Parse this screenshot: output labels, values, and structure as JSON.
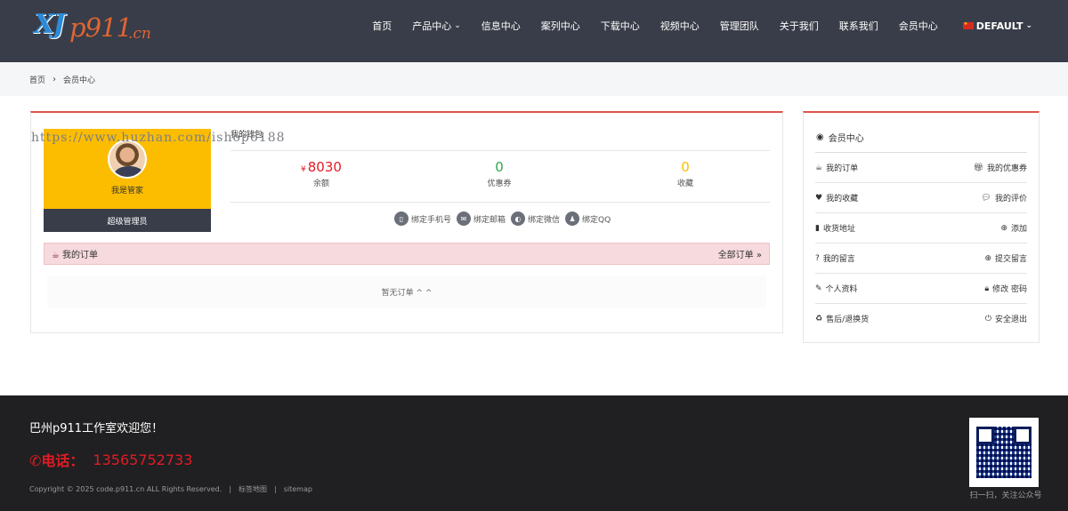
{
  "header": {
    "logo_parts": [
      "XJ",
      "p911",
      ".cn"
    ],
    "nav": [
      {
        "label": "首页",
        "chevron": false
      },
      {
        "label": "产品中心",
        "chevron": true
      },
      {
        "label": "信息中心",
        "chevron": false
      },
      {
        "label": "案列中心",
        "chevron": false
      },
      {
        "label": "下载中心",
        "chevron": false
      },
      {
        "label": "视频中心",
        "chevron": false
      },
      {
        "label": "管理团队",
        "chevron": false
      },
      {
        "label": "关于我们",
        "chevron": false
      },
      {
        "label": "联系我们",
        "chevron": false
      },
      {
        "label": "会员中心",
        "chevron": false
      }
    ],
    "language": "DEFAULT"
  },
  "breadcrumb": [
    "首页",
    "会员中心"
  ],
  "watermark": "https://www.huzhan.com/ishop6188",
  "profile": {
    "name": "我是管家",
    "role": "超级管理员"
  },
  "wallet": {
    "title": "我的钱包",
    "currency": "¥",
    "stats": [
      {
        "value": "8030",
        "label": "余额",
        "color": "#e31b23"
      },
      {
        "value": "0",
        "label": "优惠券",
        "color": "#2fa84f"
      },
      {
        "value": "0",
        "label": "收藏",
        "color": "#fcbd00"
      }
    ],
    "binds": [
      {
        "icon": "phone-icon",
        "glyph": "▯",
        "label": "绑定手机号"
      },
      {
        "icon": "mail-icon",
        "glyph": "✉",
        "label": "绑定邮箱"
      },
      {
        "icon": "wechat-icon",
        "glyph": "◐",
        "label": "绑定微信"
      },
      {
        "icon": "qq-icon",
        "glyph": "♟",
        "label": "绑定QQ"
      }
    ]
  },
  "orders": {
    "title": "我的订单",
    "all_link": "全部订单",
    "empty_text": "暂无订单 ^ ^"
  },
  "sidebar": {
    "title": "会员中心",
    "rows": [
      {
        "left": "我的订单",
        "left_icon": "orders-icon",
        "right": "我的优惠券",
        "right_icon": "gift-icon"
      },
      {
        "left": "我的收藏",
        "left_icon": "heart-icon",
        "right": "我的评价",
        "right_icon": "comments-icon"
      },
      {
        "left": "收货地址",
        "left_icon": "building-icon",
        "right": "添加",
        "right_icon": "plus-circle-icon"
      },
      {
        "left": "我的留言",
        "left_icon": "question-circle-icon",
        "right": "提交留言",
        "right_icon": "plus-circle-icon"
      },
      {
        "left": "个人资料",
        "left_icon": "edit-icon",
        "right": "修改 密码",
        "right_icon": "lock-icon"
      },
      {
        "left": "售后/退换货",
        "left_icon": "recycle-icon",
        "right": "安全退出",
        "right_icon": "power-icon"
      }
    ]
  },
  "footer": {
    "welcome": "巴州p911工作室欢迎您！",
    "phone_label": "电话：",
    "phone": "13565752733",
    "copyright": "Copyright © 2025 code.p911.cn ALL Rights Reserved.",
    "links": [
      "标签地图",
      "sitemap"
    ],
    "qr_caption": "扫一扫，关注公众号"
  }
}
